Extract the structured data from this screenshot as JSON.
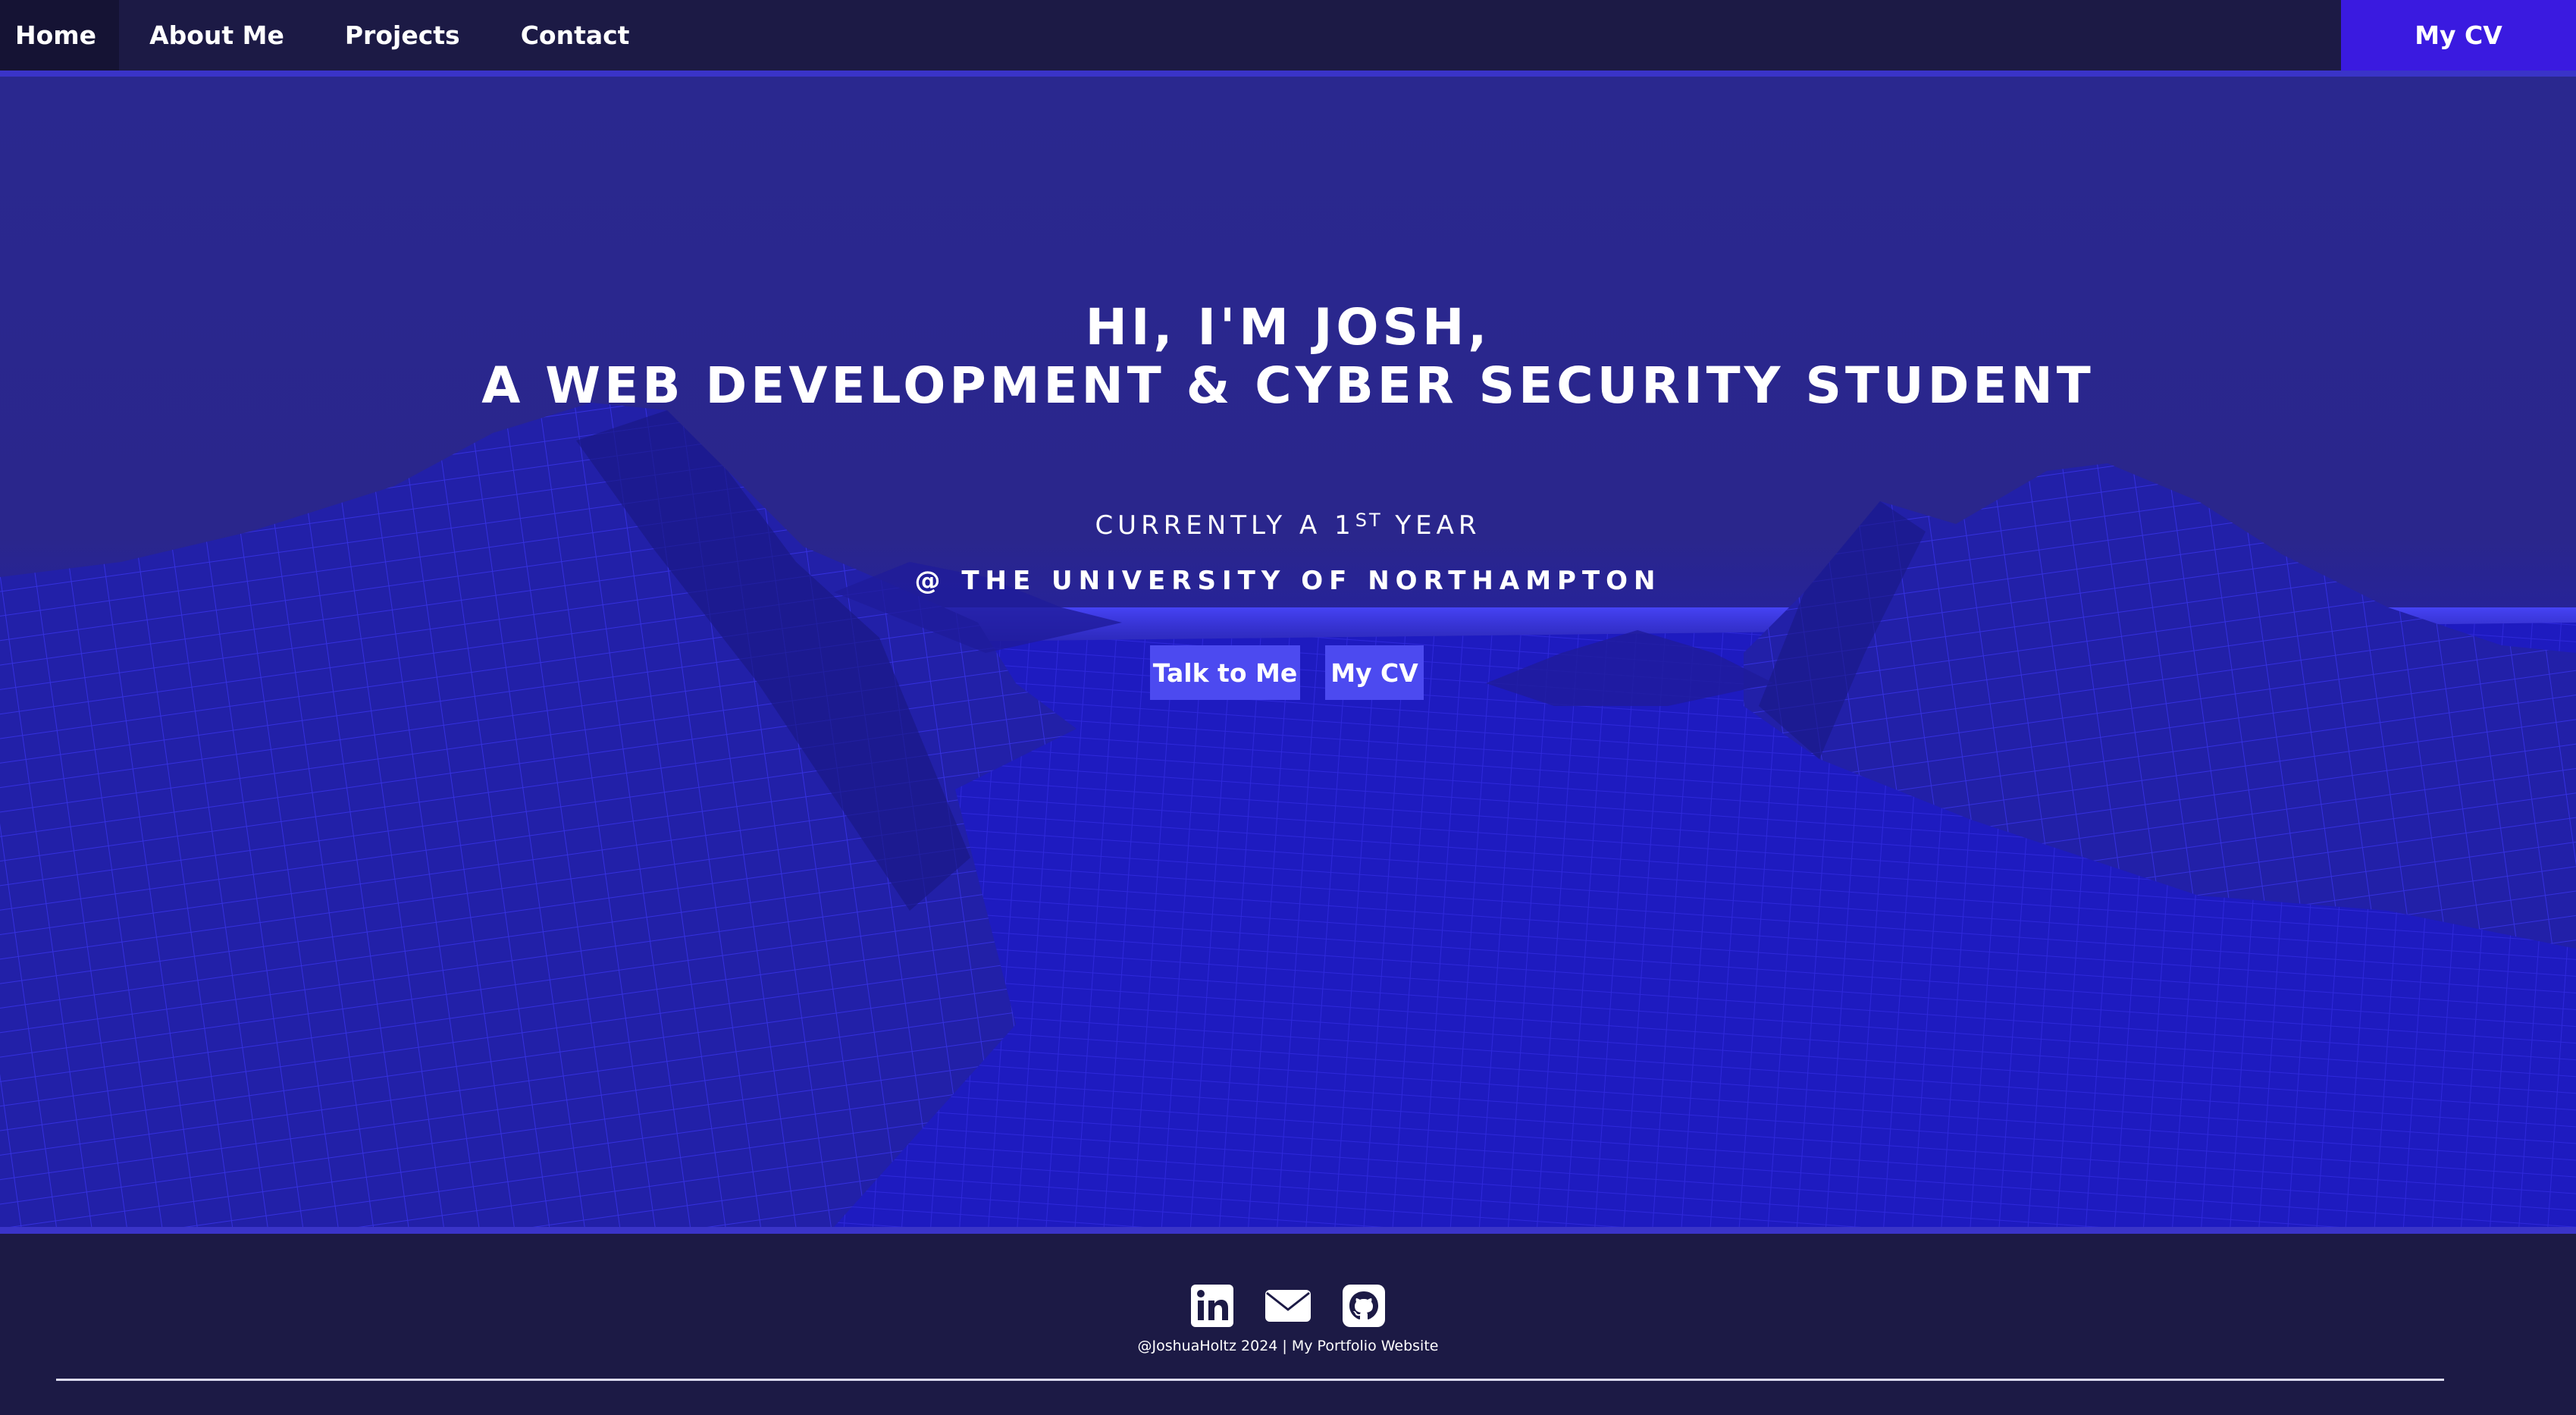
{
  "nav": {
    "items": [
      {
        "label": "Home",
        "active": true
      },
      {
        "label": "About Me"
      },
      {
        "label": "Projects"
      },
      {
        "label": "Contact"
      }
    ],
    "cv_label": "My CV"
  },
  "hero": {
    "title_line1": "HI, I'M JOSH,",
    "title_line2": "A WEB DEVELOPMENT & CYBER SECURITY STUDENT",
    "sub1_prefix": "CURRENTLY A 1",
    "sub1_sup": "ST",
    "sub1_suffix": " YEAR",
    "sub2": "@ THE UNIVERSITY OF NORTHAMPTON",
    "btn_talk": "Talk to Me",
    "btn_cv": "My CV"
  },
  "footer": {
    "social_icons": [
      "linkedin-icon",
      "email-icon",
      "github-icon"
    ],
    "copyright": "@JoshuaHoltz 2024 | My Portfolio Website"
  },
  "colors": {
    "nav_bg": "#1c1a45",
    "accent_cv": "#3a1ae0",
    "button_bg": "#4c4af0",
    "divider": "#3a34c8",
    "wire": "#3b35f0"
  }
}
